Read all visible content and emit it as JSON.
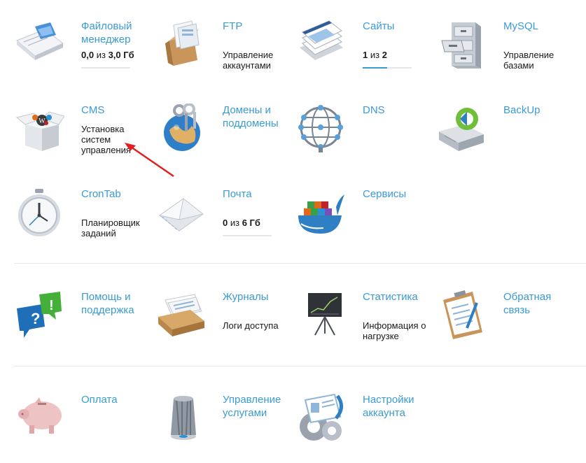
{
  "tiles": {
    "file_manager": {
      "title": "Файловый менеджер",
      "used": "0,0",
      "of": "из",
      "total": "3,0 Гб",
      "fill": 0
    },
    "ftp": {
      "title": "FTP",
      "desc": "Управление аккаунтами"
    },
    "sites": {
      "title": "Сайты",
      "used": "1",
      "of": "из",
      "total": "2",
      "fill": 0.5
    },
    "mysql": {
      "title": "MySQL",
      "desc": "Управление базами"
    },
    "cms": {
      "title": "CMS",
      "desc": "Установка систем управления"
    },
    "domains": {
      "title": "Домены и поддомены"
    },
    "dns": {
      "title": "DNS"
    },
    "backup": {
      "title": "BackUp"
    },
    "crontab": {
      "title": "CronTab",
      "desc": "Планировщик заданий"
    },
    "mail": {
      "title": "Почта",
      "used": "0",
      "of": "из",
      "total": "6 Гб",
      "fill": 0
    },
    "services": {
      "title": "Сервисы"
    },
    "help": {
      "title": "Помощь и поддержка"
    },
    "logs": {
      "title": "Журналы",
      "desc": "Логи доступа"
    },
    "stats": {
      "title": "Статистика",
      "desc": "Информация о нагрузке"
    },
    "feedback": {
      "title": "Обратная связь"
    },
    "payment": {
      "title": "Оплата"
    },
    "service_mgmt": {
      "title": "Управление услугами"
    },
    "account_settings": {
      "title": "Настройки аккаунта"
    }
  },
  "colors": {
    "link": "#3b9bd3",
    "text": "#1a1a1a",
    "annotation_arrow": "#e02020"
  }
}
